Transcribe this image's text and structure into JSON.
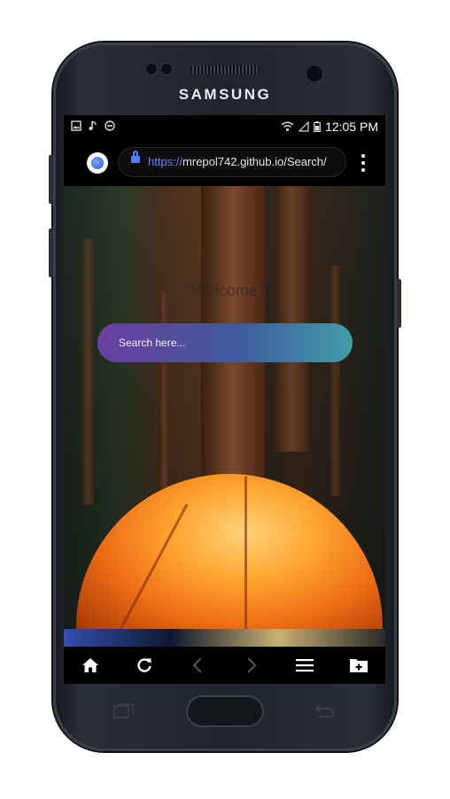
{
  "device": {
    "brand": "SAMSUNG"
  },
  "status_bar": {
    "left_icons": [
      "image-icon",
      "music-note-icon",
      "do-not-disturb-icon"
    ],
    "right_icons": [
      "wifi-icon",
      "signal-icon",
      "battery-icon"
    ],
    "time": "12:05 PM"
  },
  "browser": {
    "url_scheme": "https://",
    "url_rest": "mrepol742.github.io/Search/",
    "menu_icon": "more-vert-icon"
  },
  "page": {
    "title": "Welcome",
    "search_placeholder": "Search here..."
  },
  "bottom_nav": [
    "home-icon",
    "refresh-icon",
    "back-chevron-icon",
    "forward-chevron-icon",
    "menu-icon",
    "add-folder-icon"
  ],
  "colors": {
    "search_gradient_start": "#6b3fa0",
    "search_gradient_end": "#3f9ea5",
    "url_accent": "#5b8dff"
  }
}
